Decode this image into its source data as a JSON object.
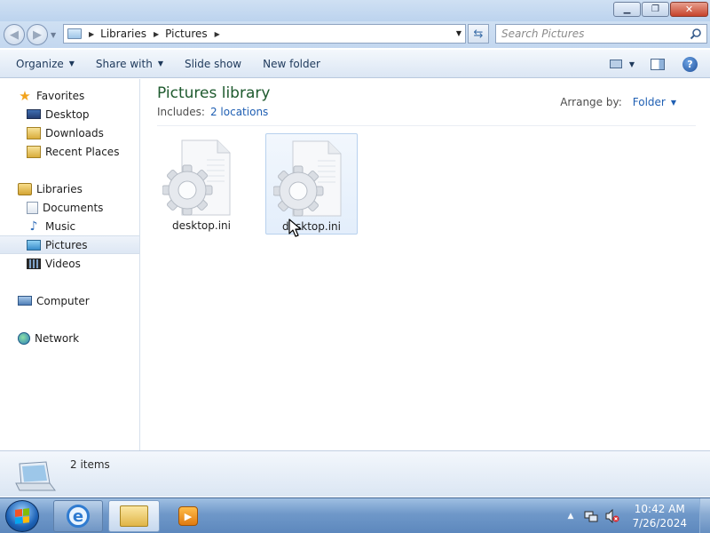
{
  "window": {
    "controls": {
      "minimize": "minimize",
      "maximize": "maximize",
      "close": "close"
    }
  },
  "address": {
    "crumbs": [
      "Libraries",
      "Pictures"
    ]
  },
  "search": {
    "placeholder": "Search Pictures"
  },
  "toolbar": {
    "organize": "Organize",
    "share_with": "Share with",
    "slide_show": "Slide show",
    "new_folder": "New folder"
  },
  "sidebar": {
    "favorites": {
      "label": "Favorites",
      "items": [
        {
          "label": "Desktop",
          "icon": "desktop-icon"
        },
        {
          "label": "Downloads",
          "icon": "downloads-icon"
        },
        {
          "label": "Recent Places",
          "icon": "recent-places-icon"
        }
      ]
    },
    "libraries": {
      "label": "Libraries",
      "items": [
        {
          "label": "Documents",
          "icon": "documents-icon"
        },
        {
          "label": "Music",
          "icon": "music-icon"
        },
        {
          "label": "Pictures",
          "icon": "pictures-icon",
          "selected": true
        },
        {
          "label": "Videos",
          "icon": "videos-icon"
        }
      ]
    },
    "computer": {
      "label": "Computer"
    },
    "network": {
      "label": "Network"
    }
  },
  "library": {
    "title": "Pictures library",
    "includes_label": "Includes:",
    "includes_link": "2 locations",
    "arrange_label": "Arrange by:",
    "arrange_value": "Folder"
  },
  "files": [
    {
      "name": "desktop.ini",
      "icon": "settings-file-icon",
      "selected": false
    },
    {
      "name": "desktop.ini",
      "icon": "settings-file-icon",
      "selected": true
    }
  ],
  "details": {
    "count": "2 items"
  },
  "taskbar": {
    "clock_time": "10:42 AM",
    "clock_date": "7/26/2024"
  },
  "colors": {
    "title_green": "#1e5a2e",
    "link_blue": "#1f5fb3",
    "taskbar": "#6f98c9"
  }
}
